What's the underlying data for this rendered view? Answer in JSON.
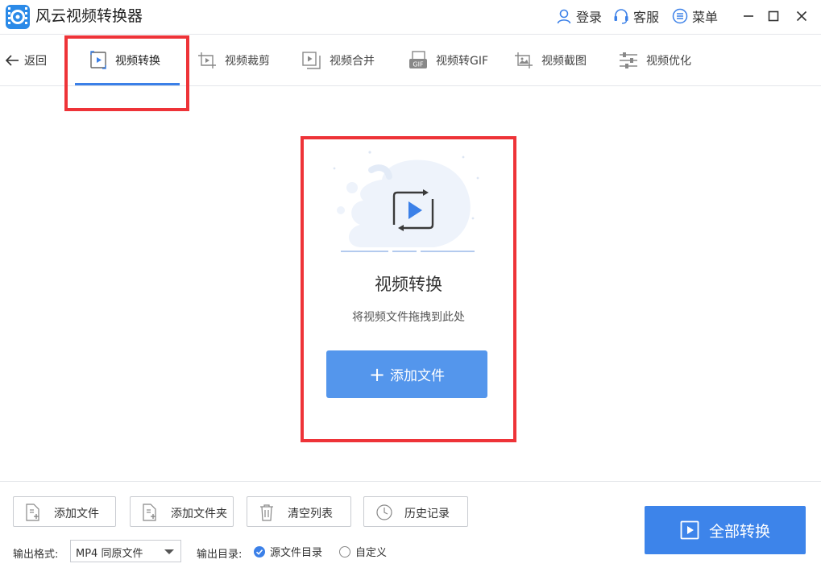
{
  "app": {
    "title": "风云视频转换器"
  },
  "titlebar": {
    "login_label": "登录",
    "service_label": "客服",
    "menu_label": "菜单"
  },
  "nav": {
    "back_label": "返回",
    "tabs": [
      {
        "label": "视频转换",
        "icon": "video-convert-icon",
        "active": true
      },
      {
        "label": "视频裁剪",
        "icon": "video-crop-icon"
      },
      {
        "label": "视频合并",
        "icon": "video-merge-icon"
      },
      {
        "label": "视频转GIF",
        "icon": "gif-icon"
      },
      {
        "label": "视频截图",
        "icon": "screenshot-icon"
      },
      {
        "label": "视频优化",
        "icon": "optimize-icon"
      }
    ]
  },
  "dropzone": {
    "title": "视频转换",
    "hint": "将视频文件拖拽到此处",
    "add_button_label": "添加文件"
  },
  "toolbar": {
    "add_file_label": "添加文件",
    "add_folder_label": "添加文件夹",
    "clear_list_label": "清空列表",
    "history_label": "历史记录"
  },
  "output": {
    "format_label": "输出格式:",
    "format_value": "MP4 同原文件",
    "dir_label": "输出目录:",
    "dir_options": [
      {
        "label": "源文件目录",
        "checked": true
      },
      {
        "label": "自定义",
        "checked": false
      }
    ]
  },
  "convert_all_label": "全部转换",
  "colors": {
    "accent": "#3b80e8",
    "highlight_box": "#ee3338",
    "button_blue": "#5496ec"
  }
}
